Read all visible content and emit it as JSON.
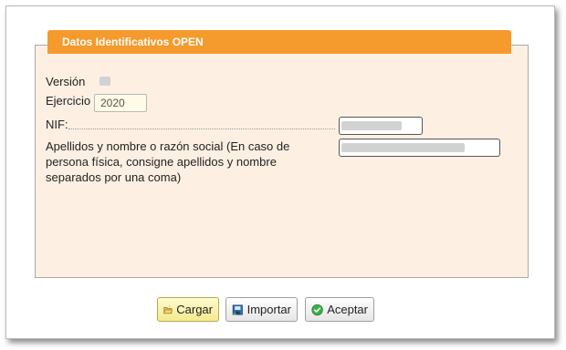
{
  "section": {
    "title": "Datos Identificativos OPEN"
  },
  "form": {
    "version_label": "Versión",
    "ejercicio_label": "Ejercicio",
    "ejercicio_value": "2020",
    "nif_label": "NIF:",
    "apellidos_label": "Apellidos y nombre o razón social (En caso de persona física, consigne apellidos y nombre separados por una coma)"
  },
  "buttons": {
    "cargar": "Cargar",
    "importar": "Importar",
    "aceptar": "Aceptar"
  },
  "colors": {
    "header": "#f59a2c",
    "panel": "#fdf0e3",
    "primary_button": "#f4ea8f"
  }
}
